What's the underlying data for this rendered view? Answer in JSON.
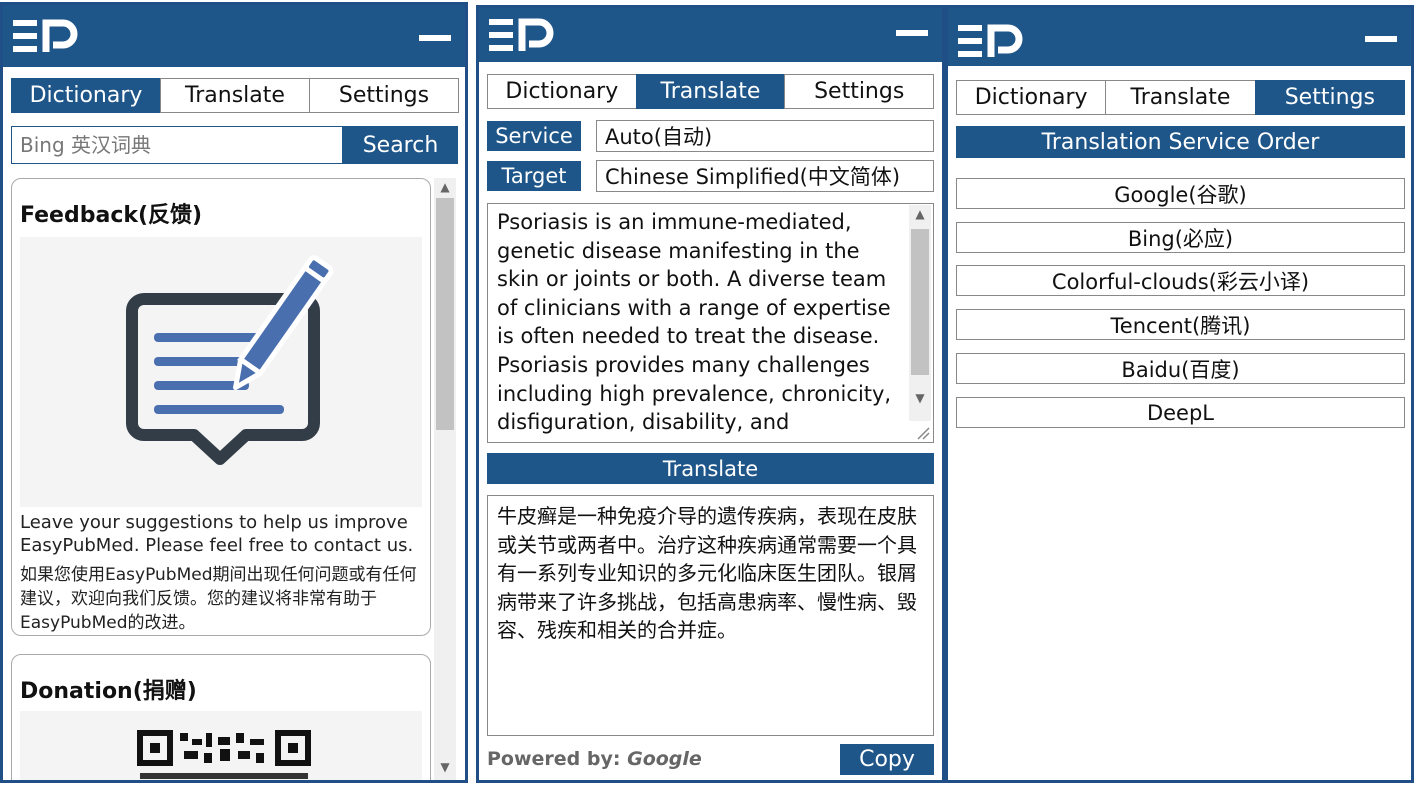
{
  "tabs": [
    "Dictionary",
    "Translate",
    "Settings"
  ],
  "colors": {
    "primary": "#1f5689",
    "border": "#1f4f86"
  },
  "dictionary": {
    "search_placeholder": "Bing 英汉词典",
    "search_label": "Search",
    "feedback": {
      "title": "Feedback(反馈)",
      "text_en": "Leave your suggestions to help us improve EasyPubMed. Please feel free to contact us.",
      "text_zh": "如果您使用EasyPubMed期间出现任何问题或有任何建议，欢迎向我们反馈。您的建议将非常有助于EasyPubMed的改进。"
    },
    "donation": {
      "title": "Donation(捐赠)"
    }
  },
  "translate": {
    "service_label": "Service",
    "service_value": "Auto(自动)",
    "target_label": "Target",
    "target_value": "Chinese Simplified(中文简体)",
    "source_text": "Psoriasis is an immune-mediated, genetic disease manifesting in the skin or joints or both. A diverse team of clinicians with a range of expertise is often needed to treat the disease. Psoriasis provides many challenges including high prevalence, chronicity, disfiguration, disability, and",
    "translate_label": "Translate",
    "result_text": "牛皮癣是一种免疫介导的遗传疾病，表现在皮肤或关节或两者中。治疗这种疾病通常需要一个具有一系列专业知识的多元化临床医生团队。银屑病带来了许多挑战，包括高患病率、慢性病、毁容、残疾和相关的合并症。",
    "powered_label": "Powered by:",
    "powered_service": "Google",
    "copy_label": "Copy"
  },
  "settings": {
    "section_title": "Translation Service Order",
    "services": [
      "Google(谷歌)",
      "Bing(必应)",
      "Colorful-clouds(彩云小译)",
      "Tencent(腾讯)",
      "Baidu(百度)",
      "DeepL"
    ]
  }
}
